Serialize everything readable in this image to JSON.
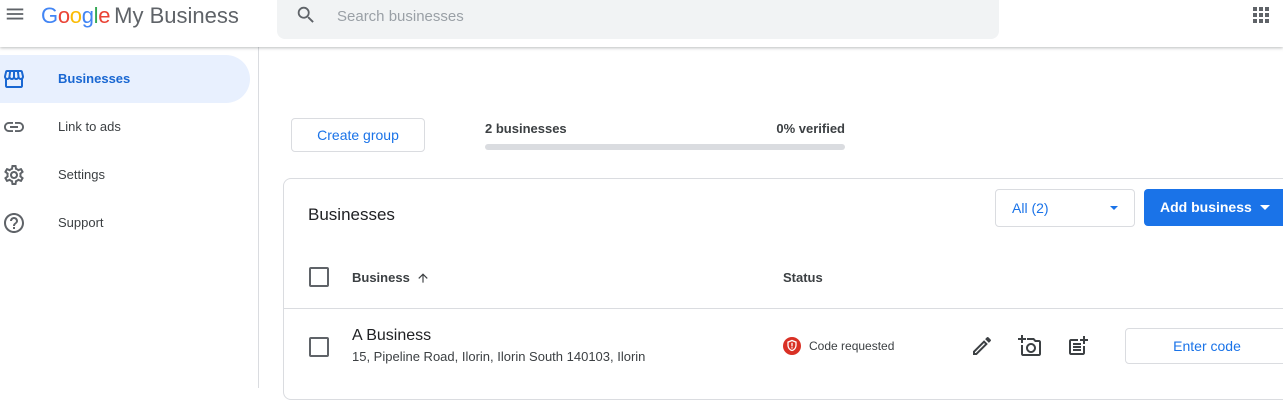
{
  "header": {
    "logo_google": "Google",
    "logo_product": "My Business",
    "search_placeholder": "Search businesses"
  },
  "icons": {
    "menu": "menu-icon",
    "search": "search-icon",
    "apps": "apps-grid-icon"
  },
  "sidebar": {
    "items": [
      {
        "label": "Businesses",
        "icon": "storefront-icon",
        "active": true
      },
      {
        "label": "Link to ads",
        "icon": "link-icon",
        "active": false
      },
      {
        "label": "Settings",
        "icon": "gear-icon",
        "active": false
      },
      {
        "label": "Support",
        "icon": "help-icon",
        "active": false
      }
    ]
  },
  "summary": {
    "create_group_label": "Create group",
    "count_label": "2 businesses",
    "verified_label": "0% verified",
    "verified_fraction": 0
  },
  "businesses_card": {
    "title": "Businesses",
    "filter_value": "All (2)",
    "add_business_label": "Add business",
    "columns": {
      "business": "Business",
      "status": "Status"
    },
    "rows": [
      {
        "name": "A Business",
        "address": "15, Pipeline Road, Ilorin, Ilorin South 140103, Ilorin",
        "status": "Code requested",
        "action_label": "Enter code"
      }
    ]
  },
  "colors": {
    "accent": "#1a73e8",
    "active_nav_bg": "#e8f0fe",
    "status_red": "#d93025"
  }
}
